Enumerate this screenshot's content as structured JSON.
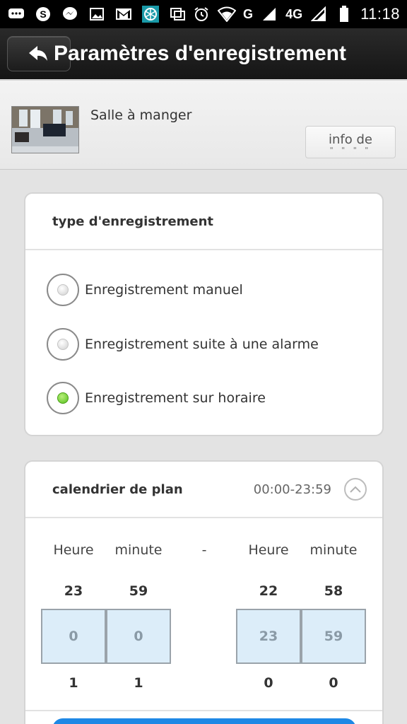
{
  "status_bar": {
    "time": "11:18",
    "network": "4G",
    "signal_badge": "G",
    "icons_left": [
      "chat-bubble-icon",
      "skype-icon",
      "messenger-icon",
      "image-icon",
      "gmail-icon",
      "app-icon",
      "copy-icon"
    ],
    "icons_right": [
      "alarm-icon",
      "wifi-icon",
      "signal-icon",
      "battery-icon"
    ]
  },
  "titlebar": {
    "title": "Paramètres d'enregistrement"
  },
  "device": {
    "name": "Salle à manger",
    "info_button": "info de"
  },
  "record_type": {
    "heading": "type d'enregistrement",
    "options": [
      {
        "label": "Enregistrement manuel",
        "selected": false
      },
      {
        "label": "Enregistrement suite à une alarme",
        "selected": false
      },
      {
        "label": "Enregistrement sur horaire",
        "selected": true
      }
    ]
  },
  "schedule": {
    "heading": "calendrier de plan",
    "range": "00:00-23:59",
    "separator": "-",
    "start": {
      "hour_label": "Heure",
      "minute_label": "minute",
      "hour_prev": "23",
      "minute_prev": "59",
      "hour": "0",
      "minute": "0",
      "hour_next": "1",
      "minute_next": "1"
    },
    "end": {
      "hour_label": "Heure",
      "minute_label": "minute",
      "hour_prev": "22",
      "minute_prev": "58",
      "hour": "23",
      "minute": "59",
      "hour_next": "0",
      "minute_next": "0"
    }
  },
  "colors": {
    "accent_blue": "#1e88e5",
    "radio_selected": "#55bf1e",
    "picker_bg": "#dcedf9"
  }
}
